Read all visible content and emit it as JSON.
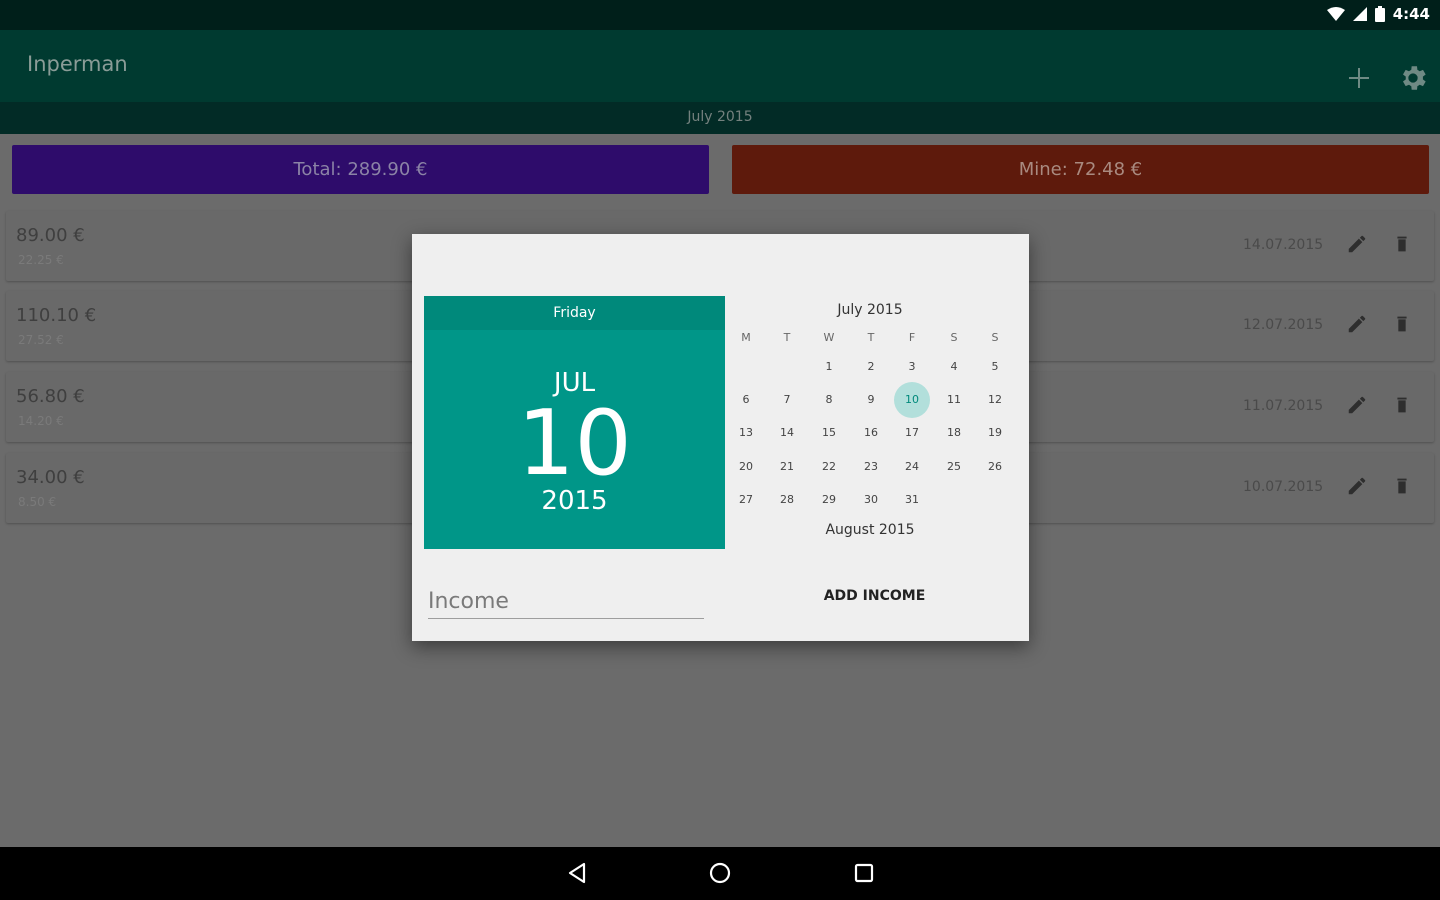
{
  "status_bar": {
    "time": "4:44",
    "icons": [
      "wifi-icon",
      "signal-icon",
      "battery-icon"
    ]
  },
  "app_bar": {
    "title": "Inperman",
    "actions": [
      "add-icon",
      "settings-icon"
    ]
  },
  "month_strip": {
    "label": "July 2015"
  },
  "summary": {
    "total_label": "Total: 289.90 €",
    "mine_label": "Mine: 72.48 €"
  },
  "expenses": [
    {
      "amount": "89.00 €",
      "share": "22.25 €",
      "date": "14.07.2015"
    },
    {
      "amount": "110.10 €",
      "share": "27.52 €",
      "date": "12.07.2015"
    },
    {
      "amount": "56.80 €",
      "share": "14.20 €",
      "date": "11.07.2015"
    },
    {
      "amount": "34.00 €",
      "share": "8.50 €",
      "date": "10.07.2015"
    }
  ],
  "dialog": {
    "header": {
      "day_of_week": "Friday",
      "month": "JUL",
      "day": "10",
      "year": "2015"
    },
    "calendar": {
      "month_title": "July 2015",
      "weekdays": [
        "M",
        "T",
        "W",
        "T",
        "F",
        "S",
        "S"
      ],
      "days": [
        [
          "",
          "",
          "1",
          "2",
          "3",
          "4",
          "5"
        ],
        [
          "6",
          "7",
          "8",
          "9",
          "10",
          "11",
          "12"
        ],
        [
          "13",
          "14",
          "15",
          "16",
          "17",
          "18",
          "19"
        ],
        [
          "20",
          "21",
          "22",
          "23",
          "24",
          "25",
          "26"
        ],
        [
          "27",
          "28",
          "29",
          "30",
          "31",
          "",
          ""
        ]
      ],
      "selected_day": "10",
      "next_month_title": "August 2015"
    },
    "income_placeholder": "Income",
    "add_income_label": "ADD INCOME"
  },
  "nav_bar": {
    "icons": [
      "back-icon",
      "home-icon",
      "recents-icon"
    ]
  },
  "colors": {
    "app_bar": "#003a30",
    "total_button": "#2e0c6b",
    "mine_button": "#5e1a0c",
    "date_header": "#009688",
    "selected_day": "#b2dfdb"
  }
}
